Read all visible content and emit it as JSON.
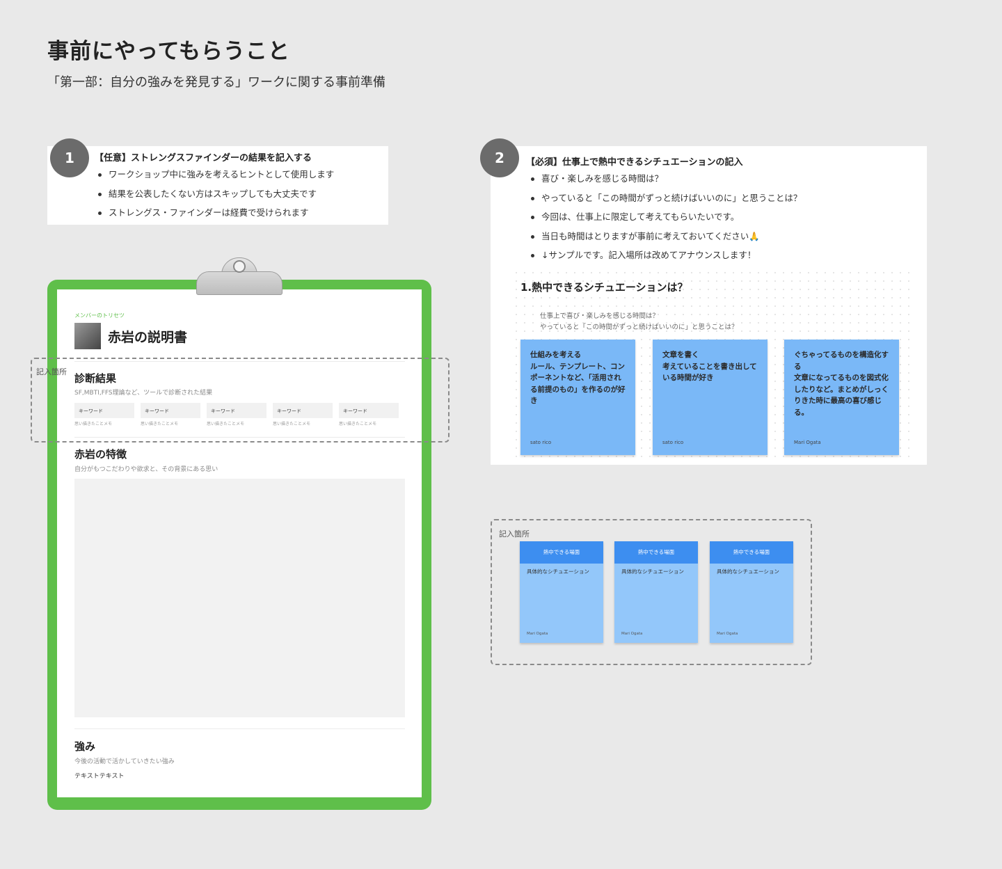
{
  "page": {
    "title": "事前にやってもらうこと",
    "subtitle": "「第一部：自分の強みを発見する」ワークに関する事前準備"
  },
  "step1": {
    "num": "1",
    "title": "【任意】ストレングスファインダーの結果を記入する",
    "bullets": [
      "ワークショップ中に強みを考えるヒントとして使用します",
      "結果を公表したくない方はスキップしても大丈夫です",
      "ストレングス・ファインダーは経費で受けられます"
    ]
  },
  "step2": {
    "num": "2",
    "title": "【必須】仕事上で熱中できるシチュエーションの記入",
    "bullets": [
      "喜び・楽しみを感じる時間は？",
      "やっていると「この時間がずっと続けばいいのに」と思うことは？",
      "今回は、仕事上に限定して考えてもらいたいです。",
      "当日も時間はとりますが事前に考えておいてください🙏",
      "↓サンプルです。記入場所は改めてアナウンスします！"
    ],
    "sample_heading": "1.熱中できるシチュエーションは？",
    "sample_hint1": "仕事上で喜び・楽しみを感じる時間は？",
    "sample_hint2": "やっていると「この時間がずっと続けばいいのに」と思うことは？",
    "stickies": [
      {
        "text": "仕組みを考える\nルール、テンプレート、コンポーネントなど、「活用される前提のもの」を作るのが好き",
        "author": "sato rico"
      },
      {
        "text": "文章を書く\n考えていることを書き出している時間が好き",
        "author": "sato rico"
      },
      {
        "text": "ぐちゃってるものを構造化する\n文章になってるものを図式化したりなど。まとめがしっくりきた時に最高の喜び感じる。",
        "author": "Mari Ogata"
      }
    ]
  },
  "board": {
    "meta_label": "メンバーのトリセツ",
    "doc_title": "赤岩の説明書",
    "sections": {
      "diag_title": "診断結果",
      "diag_sub": "SF,MBTI,FFS理論など、ツールで診断された結果",
      "feat_title": "赤岩の特徴",
      "feat_sub": "自分がもつこだわりや欲求と、その背景にある思い",
      "str_title": "強み",
      "str_sub": "今後の活動で活かしていきたい強み",
      "str_text": "テキストテキスト"
    },
    "keywords": [
      {
        "label": "キーワード",
        "note": "思い描きたことメモ"
      },
      {
        "label": "キーワード",
        "note": "思い描きたことメモ"
      },
      {
        "label": "キーワード",
        "note": "思い描きたことメモ"
      },
      {
        "label": "キーワード",
        "note": "思い描きたことメモ"
      },
      {
        "label": "キーワード",
        "note": "思い描きたことメモ"
      }
    ]
  },
  "entry_area_label": "記入箇所",
  "templates": [
    {
      "head": "熱中できる場面",
      "body": "具体的なシチュエーション",
      "author": "Mari Ogata"
    },
    {
      "head": "熱中できる場面",
      "body": "具体的なシチュエーション",
      "author": "Mari Ogata"
    },
    {
      "head": "熱中できる場面",
      "body": "具体的なシチュエーション",
      "author": "Mari Ogata"
    }
  ],
  "colors": {
    "board": "#5fbf4a",
    "sticky": "#7ab8f7",
    "template_head": "#3d8ef0",
    "template_body": "#93c7fa"
  }
}
